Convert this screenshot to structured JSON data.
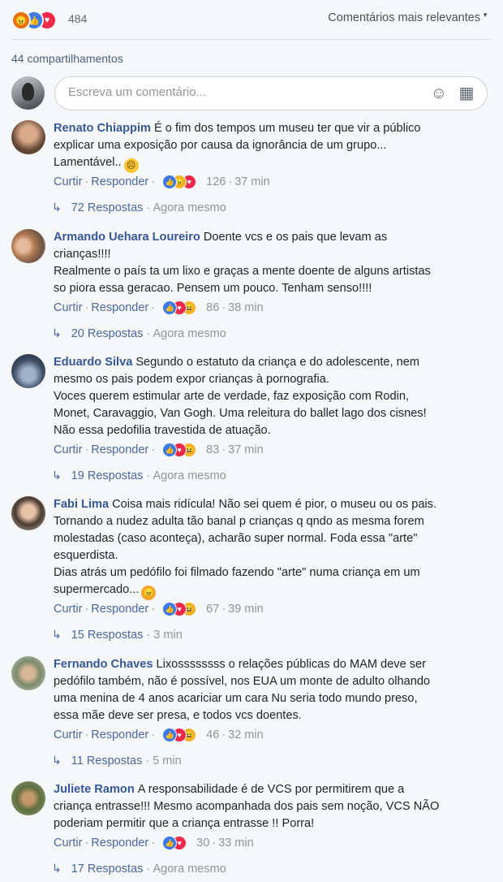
{
  "header": {
    "reaction_count": "484",
    "sort_label": "Comentários mais relevantes",
    "shares": "44 compartilhamentos",
    "reaction_icons": [
      "angry-icon",
      "like-icon",
      "love-icon"
    ]
  },
  "composer": {
    "placeholder": "Escreva um comentário..."
  },
  "labels": {
    "like": "Curtir",
    "reply": "Responder"
  },
  "comments": [
    {
      "author": "Renato Chiappim",
      "lines": [
        "É o fim dos tempos um museu ter que vir a público",
        "explicar uma exposição por causa da ignorância de um grupo...",
        "Lamentável.."
      ],
      "reactions": "126",
      "time": "37 min",
      "replies": "72 Respostas",
      "reply_time": "Agora mesmo"
    },
    {
      "author": "Armando Uehara Loureiro",
      "lines": [
        "Doente vcs e os pais que levam as",
        "crianças!!!!",
        "Realmente o país ta um lixo e graças a mente doente de alguns artistas",
        "so piora essa geracao. Pensem um pouco. Tenham senso!!!!"
      ],
      "reactions": "86",
      "time": "38 min",
      "replies": "20 Respostas",
      "reply_time": "Agora mesmo"
    },
    {
      "author": "Eduardo Silva",
      "lines": [
        "Segundo o estatuto da criança e do adolescente, nem",
        "mesmo os pais podem expor crianças à pornografia.",
        "Voces querem estimular arte de verdade, faz exposição com Rodin,",
        "Monet, Caravaggio, Van Gogh. Uma releitura do ballet lago dos cisnes!",
        "Não essa pedofilia travestida de atuação."
      ],
      "reactions": "83",
      "time": "37 min",
      "replies": "19 Respostas",
      "reply_time": "Agora mesmo"
    },
    {
      "author": "Fabi Lima",
      "lines": [
        "Coisa mais ridícula! Não sei quem é pior, o museu ou os pais.",
        "Tornando a nudez adulta tão banal p crianças q qndo as mesma forem",
        "molestadas (caso aconteça), acharão super normal. Foda essa \"arte\"",
        "esquerdista.",
        "Dias atrás um pedófilo foi filmado fazendo \"arte\" numa criança em um",
        "supermercado..."
      ],
      "reactions": "67",
      "time": "39 min",
      "replies": "15 Respostas",
      "reply_time": "3 min"
    },
    {
      "author": "Fernando Chaves",
      "lines": [
        "Lixossssssss o relações públicas do MAM deve ser",
        "pedófilo também, não é possível, nos EUA um monte de adulto olhando",
        "uma menina de 4 anos acariciar um cara Nu seria todo mundo preso,",
        "essa mãe deve ser presa, e todos vcs doentes."
      ],
      "reactions": "46",
      "time": "32 min",
      "replies": "11 Respostas",
      "reply_time": "5 min"
    },
    {
      "author": "Juliete Ramon",
      "lines": [
        "A responsabilidade é de VCS por permitirem que a",
        "criança entrasse!!! Mesmo acompanhada dos pais sem noção, VCS NÃO",
        "poderiam permitir que a criança entrasse !! Porra!"
      ],
      "reactions": "30",
      "time": "33 min",
      "replies": "17 Respostas",
      "reply_time": "Agora mesmo"
    }
  ]
}
